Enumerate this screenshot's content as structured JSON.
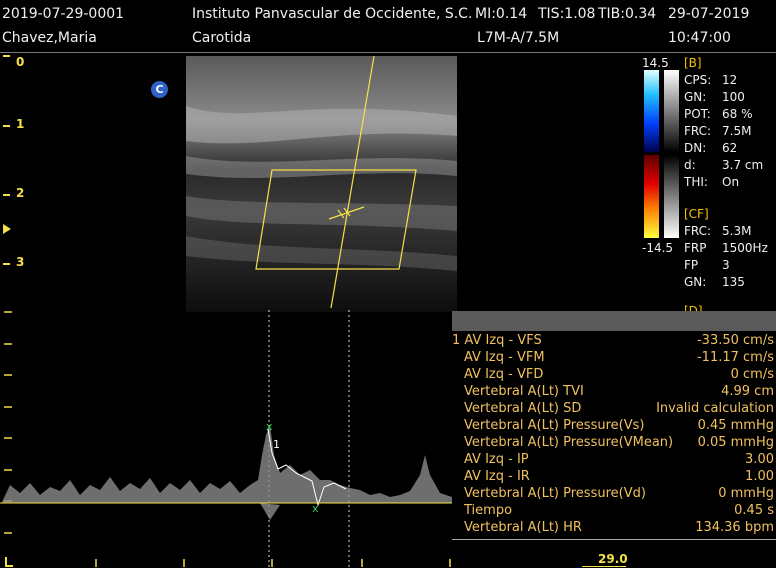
{
  "header": {
    "exam_id": "2019-07-29-0001",
    "institution": "Instituto Panvascular de Occidente, S.C.",
    "mi": "MI:0.14",
    "tis": "TIS:1.08",
    "tib": "TIB:0.34",
    "date": "29-07-2019",
    "patient": "Chavez,Maria",
    "study": "Carotida",
    "probe": "L7M-A/7.5M",
    "time": "10:47:00"
  },
  "depth_labels": [
    "0",
    "1",
    "2",
    "3"
  ],
  "marker": "C",
  "colorbar": {
    "top": "14.5",
    "bottom": "-14.5"
  },
  "b_params": {
    "header": "[B]",
    "rows": [
      {
        "k": "CPS:",
        "v": "12"
      },
      {
        "k": "GN:",
        "v": "100"
      },
      {
        "k": "POT:",
        "v": "68 %"
      },
      {
        "k": "FRC:",
        "v": "7.5M"
      },
      {
        "k": "DN:",
        "v": "62"
      },
      {
        "k": "d:",
        "v": "3.7 cm"
      },
      {
        "k": "THI:",
        "v": "On"
      }
    ]
  },
  "cf_params": {
    "header": "[CF]",
    "rows": [
      {
        "k": "FRC:",
        "v": "5.3M"
      },
      {
        "k": "FRP",
        "v": "1500Hz"
      },
      {
        "k": "FP",
        "v": "3"
      },
      {
        "k": "GN:",
        "v": "135"
      }
    ],
    "partial": "[D]"
  },
  "measurements": [
    {
      "label": "1 AV Izq - VFS",
      "value": "-33.50 cm/s"
    },
    {
      "label": "AV Izq - VFM",
      "value": "-11.17 cm/s"
    },
    {
      "label": "AV Izq - VFD",
      "value": "0 cm/s"
    },
    {
      "label": "Vertebral A(Lt) TVI",
      "value": "4.99 cm"
    },
    {
      "label": "Vertebral A(Lt) SD",
      "value": "Invalid calculation"
    },
    {
      "label": "Vertebral A(Lt) Pressure(Vs)",
      "value": "0.45 mmHg"
    },
    {
      "label": "Vertebral A(Lt) Pressure(VMean)",
      "value": "0.05 mmHg"
    },
    {
      "label": "AV Izq - IP",
      "value": "3.00"
    },
    {
      "label": "AV Izq - IR",
      "value": "1.00"
    },
    {
      "label": "Vertebral A(Lt) Pressure(Vd)",
      "value": "0 mmHg"
    },
    {
      "label": "Tiempo",
      "value": "0.45 s"
    },
    {
      "label": "Vertebral A(Lt) HR",
      "value": "134.36 bpm"
    }
  ],
  "spectrum": {
    "caliper_label": "1",
    "speed_value": "29.0"
  },
  "colors": {
    "accent_yellow": "#f5e04a",
    "text_orange": "#f0c060",
    "panel_gray": "#555555"
  }
}
